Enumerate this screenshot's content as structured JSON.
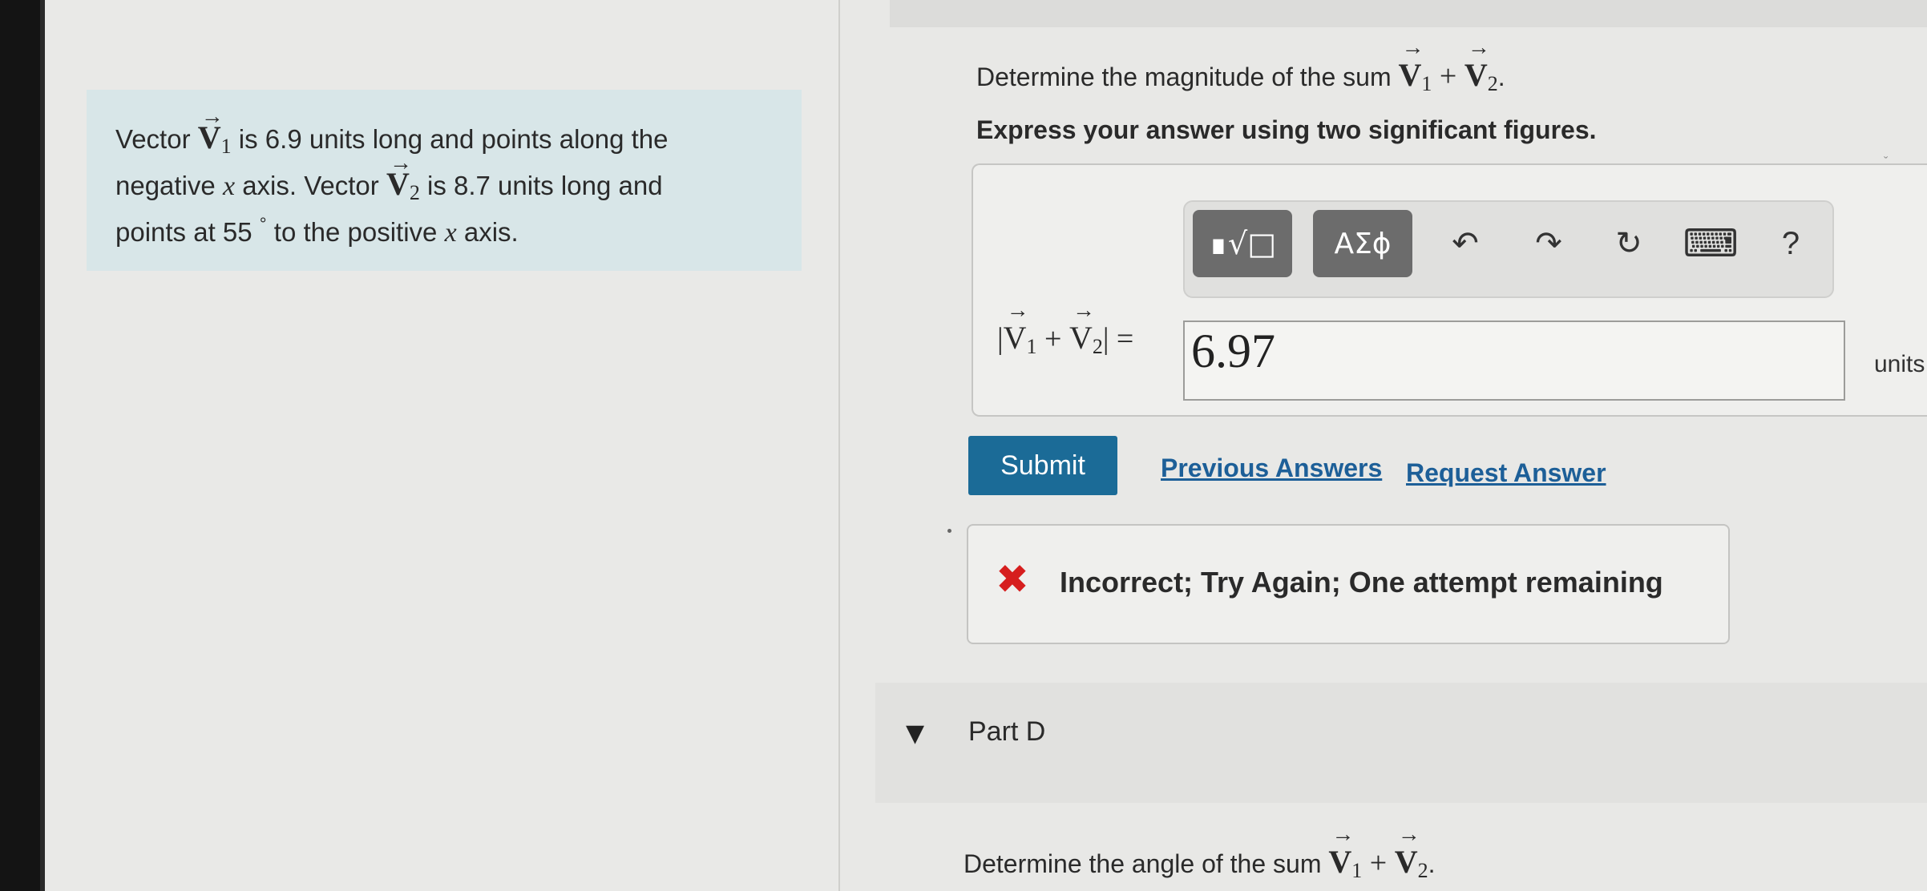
{
  "problem": {
    "vector_label": "V",
    "sub1": "1",
    "sub2": "2",
    "line1_pre": "Vector ",
    "line1_post": " is 6.9 units long and points along the",
    "line2_pre": "negative ",
    "var_x": "x",
    "line2_mid": " axis. Vector ",
    "line2_post": " is 8.7 units long and",
    "line3_pre": "points at 55 ",
    "degree": "°",
    "line3_mid": " to the positive ",
    "line3_post": " axis."
  },
  "part_c": {
    "question_pre": "Determine the magnitude of the sum ",
    "plus": " + ",
    "period": ".",
    "instruction": "Express your answer using two significant figures.",
    "toolbar": {
      "template_button": "∎√□",
      "greek_button": "ΑΣϕ",
      "undo_icon": "↶",
      "redo_icon": "↷",
      "reset_icon": "↻",
      "keyboard_icon": "⌨",
      "help_icon": "?"
    },
    "expression_lhs_open": "|",
    "expression_lhs_close": "| =",
    "answer_value": "6.97",
    "units_label": "units",
    "submit_label": "Submit",
    "previous_answers_label": "Previous Answers",
    "request_answer_label": "Request Answer",
    "feedback_icon": "✖",
    "feedback_text": "Incorrect; Try Again; One attempt remaining"
  },
  "part_d": {
    "toggle_icon": "▼",
    "label": "Part D",
    "question_pre": "Determine the angle of the sum ",
    "plus": " + ",
    "period": "."
  },
  "colors": {
    "problem_box": "#d8e6e8",
    "submit": "#1b6b97",
    "link": "#1d5f98",
    "error": "#d61e1e"
  }
}
